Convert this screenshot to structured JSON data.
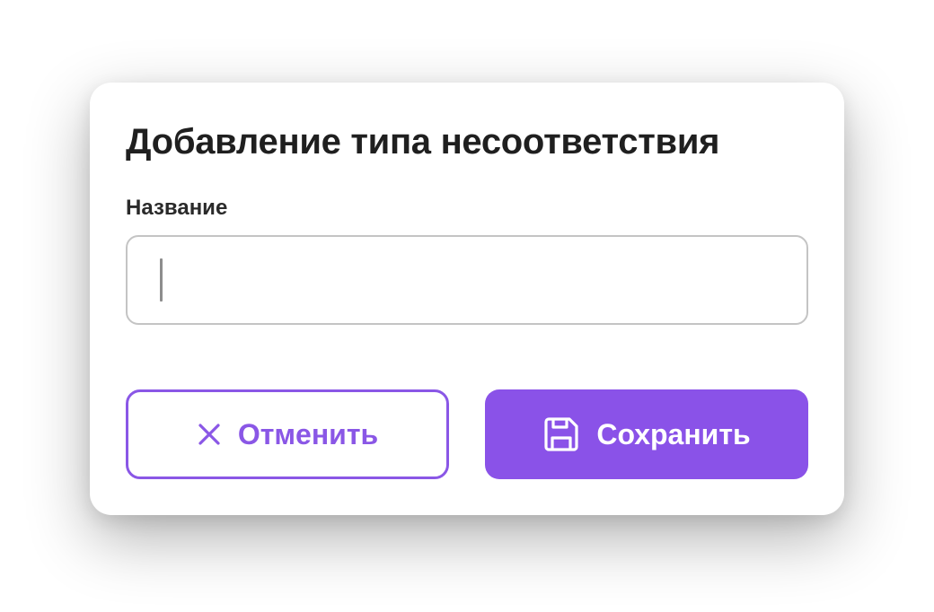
{
  "dialog": {
    "title": "Добавление типа несоответствия",
    "name_field": {
      "label": "Название",
      "value": "",
      "placeholder": ""
    },
    "buttons": {
      "cancel": {
        "label": "Отменить",
        "icon": "close-icon"
      },
      "save": {
        "label": "Сохранить",
        "icon": "floppy-disk-icon"
      }
    }
  },
  "colors": {
    "accent": "#8a52e8",
    "text": "#1f1f1f",
    "input_border": "#c4c4c4"
  }
}
